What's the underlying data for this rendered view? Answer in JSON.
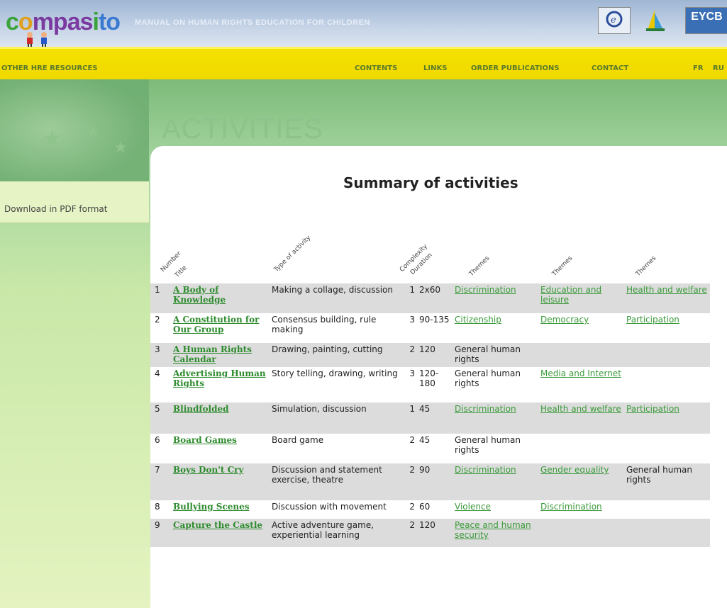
{
  "header": {
    "logo": {
      "c": "c",
      "o": "o",
      "mpas": "mpas",
      "i": "i",
      "to": "to"
    },
    "subtitle": "MANUAL ON HUMAN RIGHTS EDUCATION FOR CHILDREN",
    "badge_right": "EYCB"
  },
  "nav": {
    "other": "OTHER HRE RESOURCES",
    "contents": "CONTENTS",
    "links": "LINKS",
    "order": "ORDER PUBLICATIONS",
    "contact": "CONTACT",
    "fr": "FR",
    "ru": "RU"
  },
  "section_title": "ACTIVITIES",
  "sidebar": {
    "download": "Download in PDF format"
  },
  "summary_title": "Summary of activities",
  "columns": {
    "number": "Number",
    "title": "Title",
    "type": "Type of activity",
    "complexity": "Complexity",
    "duration": "Duration",
    "themes1": "Themes",
    "themes2": "Themes",
    "themes3": "Themes"
  },
  "rows": [
    {
      "n": "1",
      "title": "A Body of Knowledge",
      "type": "Making a collage, discussion",
      "cx": "1",
      "dur": "2x60",
      "t1": "Discrimination",
      "t1link": true,
      "t2": "Education and leisure",
      "t2link": true,
      "t3": "Health and welfare",
      "t3link": true
    },
    {
      "n": "2",
      "title": "A Constitution for Our Group",
      "type": "Consensus building, rule making",
      "cx": "3",
      "dur": "90-135",
      "t1": "Citizenship",
      "t1link": true,
      "t2": "Democracy",
      "t2link": true,
      "t3": "Participation",
      "t3link": true
    },
    {
      "n": "3",
      "title": "A Human Rights Calendar",
      "type": "Drawing, painting, cutting",
      "cx": "2",
      "dur": "120",
      "t1": "General human rights",
      "t1link": false,
      "t2": "",
      "t2link": false,
      "t3": "",
      "t3link": false
    },
    {
      "n": "4",
      "title": "Advertising Human Rights",
      "type": "Story telling, drawing, writing",
      "cx": "3",
      "dur": "120-180",
      "t1": "General human rights",
      "t1link": false,
      "t2": "Media and Internet",
      "t2link": true,
      "t3": "",
      "t3link": false
    },
    {
      "n": "5",
      "title": "Blindfolded",
      "type": "Simulation, discussion",
      "cx": "1",
      "dur": "45",
      "t1": "Discrimination",
      "t1link": true,
      "t2": "Health and welfare",
      "t2link": true,
      "t3": "Participation",
      "t3link": true
    },
    {
      "n": "6",
      "title": "Board Games",
      "type": "Board game",
      "cx": "2",
      "dur": "45",
      "t1": "General human rights",
      "t1link": false,
      "t2": "",
      "t2link": false,
      "t3": "",
      "t3link": false
    },
    {
      "n": "7",
      "title": "Boys Don't Cry",
      "type": "Discussion and statement exercise, theatre",
      "cx": "2",
      "dur": "90",
      "t1": "Discrimination",
      "t1link": true,
      "t2": "Gender equality",
      "t2link": true,
      "t3": "General human rights",
      "t3link": false
    },
    {
      "n": "8",
      "title": "Bullying Scenes",
      "type": "Discussion with movement",
      "cx": "2",
      "dur": "60",
      "t1": "Violence",
      "t1link": true,
      "t2": "Discrimination",
      "t2link": true,
      "t3": "",
      "t3link": false
    },
    {
      "n": "9",
      "title": "Capture the Castle",
      "type": "Active adventure game, experiential learning",
      "cx": "2",
      "dur": "120",
      "t1": "Peace and human security",
      "t1link": true,
      "t2": "",
      "t2link": false,
      "t3": "",
      "t3link": false
    }
  ]
}
